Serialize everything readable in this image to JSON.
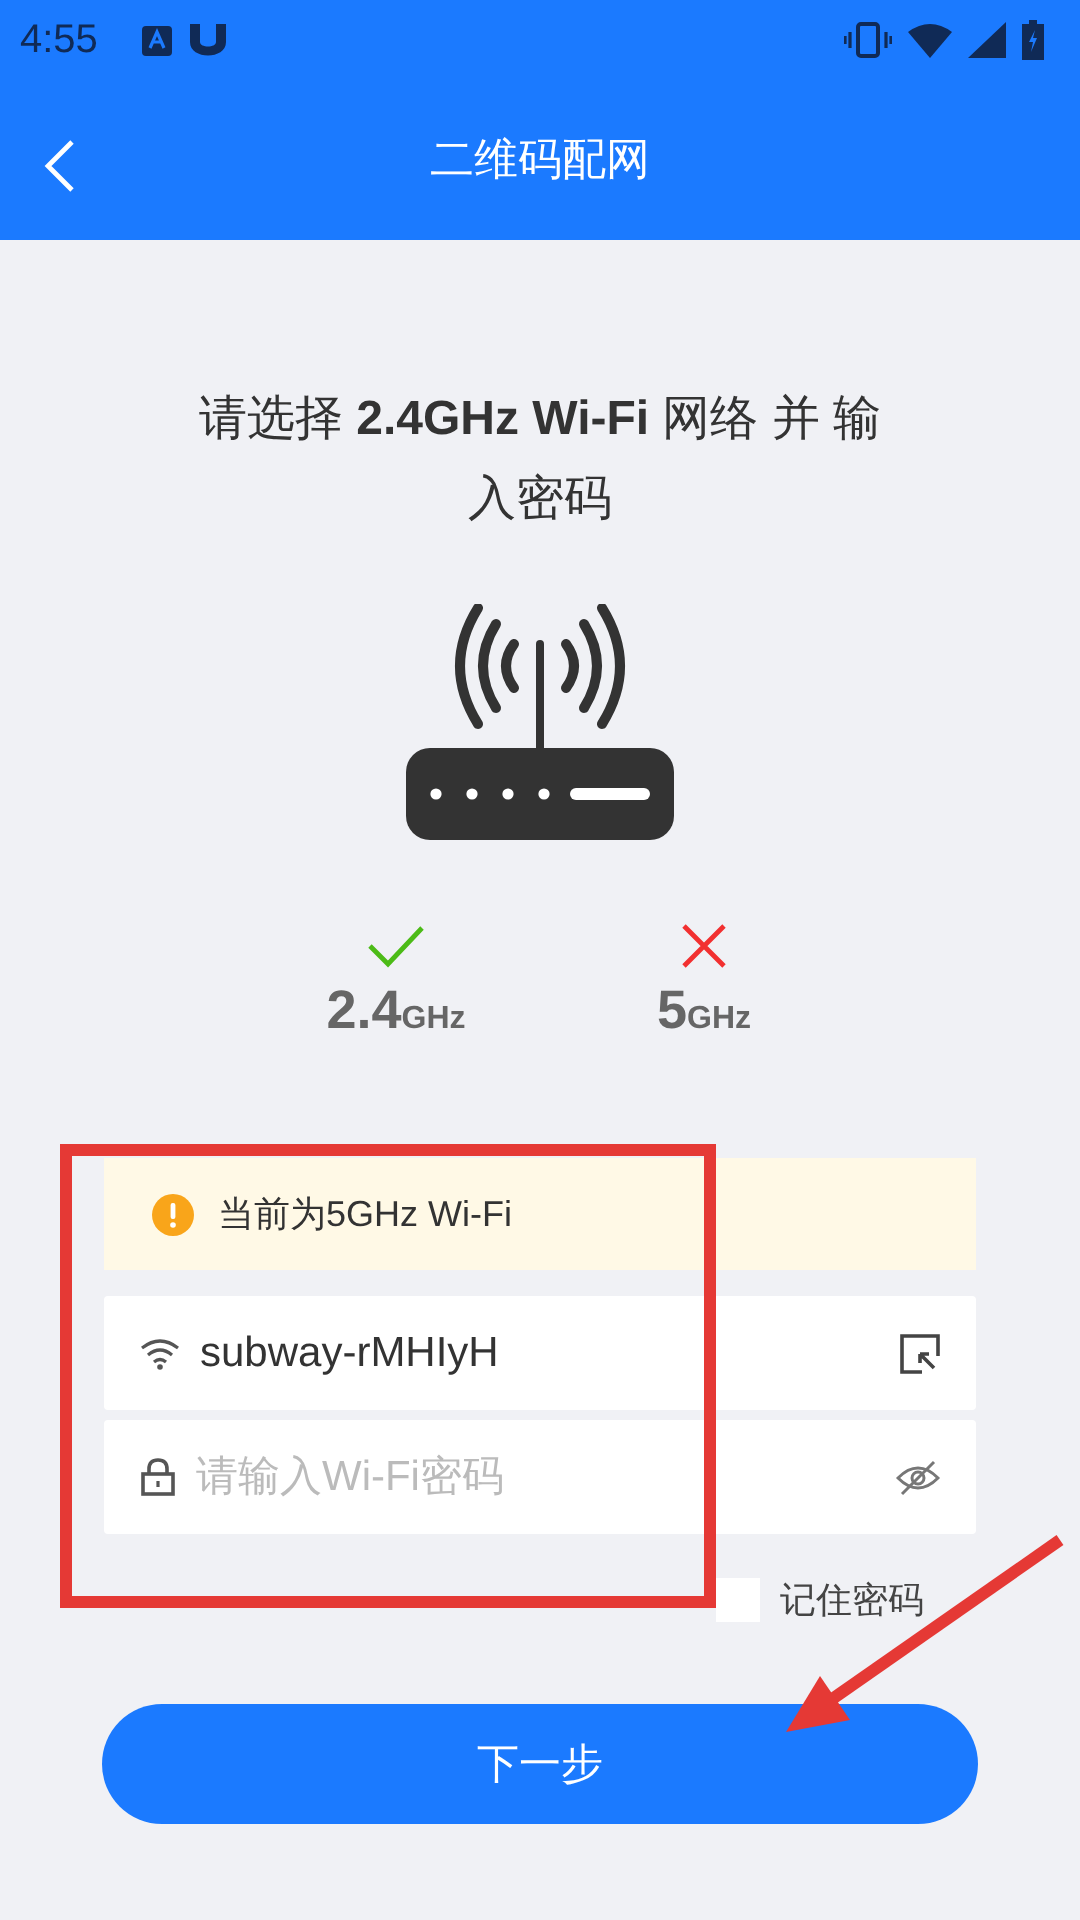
{
  "status_bar": {
    "time": "4:55"
  },
  "header": {
    "title": "二维码配网"
  },
  "instruction": "请选择 **2.4GHz Wi-Fi** 网络 并 输入密码",
  "bands": [
    {
      "value": "2.4",
      "unit": "GHz",
      "supported": true
    },
    {
      "value": "5",
      "unit": "GHz",
      "supported": false
    }
  ],
  "warning": "当前为5GHz Wi-Fi",
  "ssid_field": {
    "value": "subway-rMHIyH"
  },
  "password_field": {
    "placeholder": "请输入Wi-Fi密码"
  },
  "remember": {
    "label": "记住密码",
    "checked": false
  },
  "next_button": "下一步"
}
